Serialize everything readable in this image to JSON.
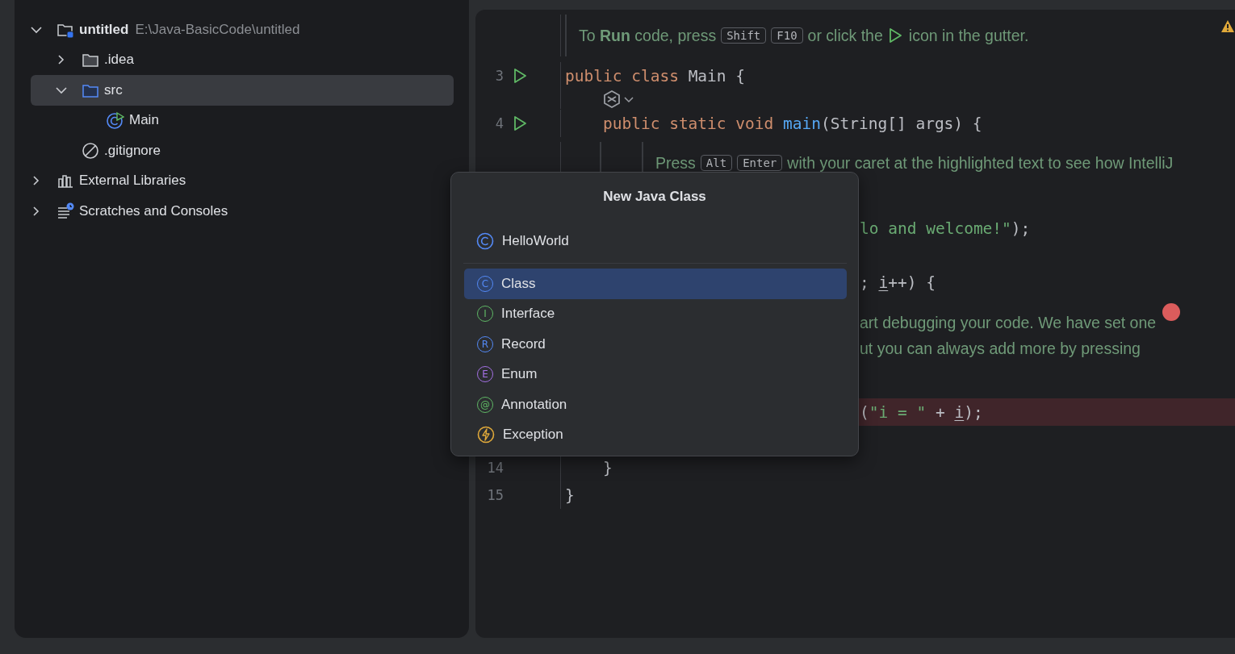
{
  "project_tree": {
    "items": [
      {
        "label": "untitled",
        "path": "E:\\Java-BasicCode\\untitled",
        "kind": "module",
        "expanded": true,
        "selected": false,
        "children": [
          {
            "label": ".idea",
            "kind": "folder",
            "expanded": false,
            "selected": false
          },
          {
            "label": "src",
            "kind": "source-folder",
            "expanded": true,
            "selected": true,
            "children": [
              {
                "label": "Main",
                "kind": "class-run",
                "selected": false
              }
            ]
          },
          {
            "label": ".gitignore",
            "kind": "ignored",
            "selected": false
          }
        ]
      },
      {
        "label": "External Libraries",
        "kind": "libraries",
        "expanded": false,
        "selected": false
      },
      {
        "label": "Scratches and Consoles",
        "kind": "scratches",
        "expanded": false,
        "selected": false
      }
    ]
  },
  "editor": {
    "rows": [
      {
        "kind": "doc",
        "parts": [
          {
            "kind": "text",
            "text": "To **Run** code, press"
          },
          {
            "kind": "key",
            "text": "Shift"
          },
          {
            "kind": "key",
            "text": "F10"
          },
          {
            "kind": "text",
            "text": "or click the"
          },
          {
            "kind": "run-icon"
          },
          {
            "kind": "text",
            "text": "icon in the gutter."
          }
        ]
      },
      {
        "kind": "code",
        "number": "3",
        "run": true,
        "breakpoint": false,
        "tokens": [
          {
            "kind": "keyword",
            "text": "public class "
          },
          {
            "kind": "plain",
            "text": "Main {"
          }
        ]
      },
      {
        "kind": "inlay"
      },
      {
        "kind": "code",
        "number": "4",
        "run": true,
        "breakpoint": false,
        "tokens": [
          {
            "kind": "keyword",
            "text": "    public static void "
          },
          {
            "kind": "method",
            "text": "main"
          },
          {
            "kind": "plain",
            "text": "(String[] args) {"
          }
        ]
      },
      {
        "kind": "doc",
        "parts": [
          {
            "kind": "text",
            "text": "Press"
          },
          {
            "kind": "key",
            "text": "Alt"
          },
          {
            "kind": "key",
            "text": "Enter"
          },
          {
            "kind": "text",
            "text": "with your caret at the highlighted text to see how IntelliJ"
          }
        ]
      },
      {
        "kind": "fragment",
        "breakpoint": false,
        "tokens": [
          {
            "kind": "string",
            "text": "lo and welcome!\""
          },
          {
            "kind": "plain",
            "text": ");"
          }
        ]
      },
      {
        "kind": "fragment",
        "breakpoint": false,
        "tokens": [
          {
            "kind": "plain",
            "text": "; "
          },
          {
            "kind": "var",
            "text": "i"
          },
          {
            "kind": "plain",
            "text": "++) {"
          }
        ]
      },
      {
        "kind": "doc-fragment",
        "parts": [
          {
            "kind": "text",
            "text": "art debugging your code. We have set one"
          },
          {
            "kind": "breakpoint-icon"
          }
        ]
      },
      {
        "kind": "doc-fragment",
        "parts": [
          {
            "kind": "text",
            "text": "ut you can always add more by pressing"
          }
        ]
      },
      {
        "kind": "fragment",
        "breakpoint": true,
        "tokens": [
          {
            "kind": "plain",
            "text": "("
          },
          {
            "kind": "string",
            "text": "\"i = \""
          },
          {
            "kind": "plain",
            "text": " + "
          },
          {
            "kind": "var",
            "text": "i"
          },
          {
            "kind": "plain",
            "text": ");"
          }
        ]
      },
      {
        "kind": "code",
        "number": "14",
        "run": false,
        "breakpoint": false,
        "tokens": [
          {
            "kind": "plain",
            "text": "    }"
          }
        ]
      },
      {
        "kind": "code",
        "number": "15",
        "run": false,
        "breakpoint": false,
        "tokens": [
          {
            "kind": "plain",
            "text": "}"
          }
        ]
      }
    ]
  },
  "dialog": {
    "title": "New Java Class",
    "name_value": "HelloWorld",
    "options": [
      {
        "label": "Class",
        "kind": "letter",
        "glyph": "C",
        "color": "#548af7",
        "selected": true
      },
      {
        "label": "Interface",
        "kind": "letter",
        "glyph": "I",
        "color": "#5fb865",
        "selected": false
      },
      {
        "label": "Record",
        "kind": "letter",
        "glyph": "R",
        "color": "#548af7",
        "selected": false
      },
      {
        "label": "Enum",
        "kind": "letter",
        "glyph": "E",
        "color": "#a571e6",
        "selected": false
      },
      {
        "label": "Annotation",
        "kind": "letter",
        "glyph": "@",
        "color": "#5fb865",
        "selected": false
      },
      {
        "label": "Exception",
        "kind": "bolt",
        "color": "#e0a93a",
        "selected": false
      }
    ]
  }
}
